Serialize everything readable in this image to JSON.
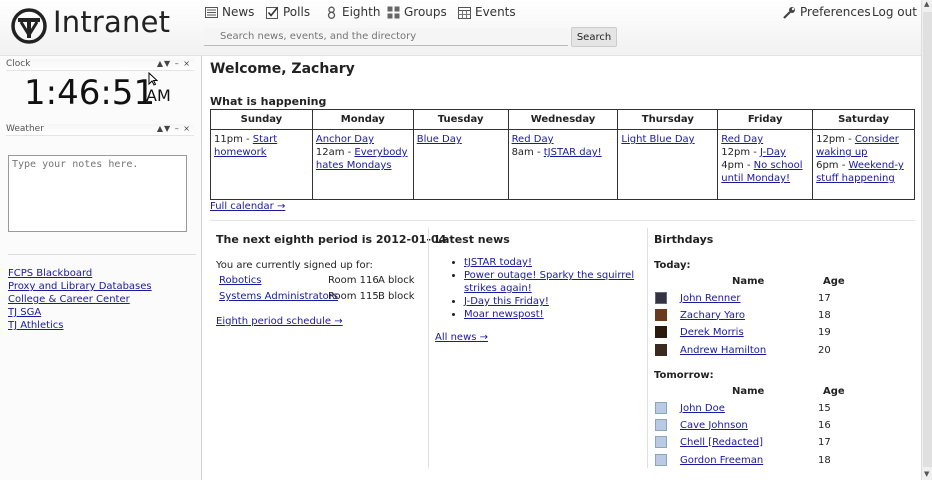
{
  "header": {
    "brand": "Intranet",
    "nav": [
      {
        "label": "News",
        "icon": "news-icon"
      },
      {
        "label": "Polls",
        "icon": "check-icon"
      },
      {
        "label": "Eighth",
        "icon": "eight-icon"
      },
      {
        "label": "Groups",
        "icon": "groups-icon"
      },
      {
        "label": "Events",
        "icon": "calendar-icon"
      }
    ],
    "preferences": "Preferences",
    "logout": "Log out",
    "search_placeholder": "Search news, events, and the directory",
    "search_button": "Search"
  },
  "sidebar": {
    "clock_title": "Clock",
    "time": "1:46:51",
    "ampm": "AM",
    "weather_title": "Weather",
    "widget_controls": "▲▼ – ×",
    "notes_placeholder": "Type your notes here.",
    "links": [
      "FCPS Blackboard",
      "Proxy and Library Databases",
      "College & Career Center",
      "TJ SGA",
      "TJ Athletics"
    ]
  },
  "main": {
    "welcome": "Welcome, Zachary",
    "happening_title": "What is happening",
    "days": [
      "Sunday",
      "Monday",
      "Tuesday",
      "Wednesday",
      "Thursday",
      "Friday",
      "Saturday"
    ],
    "calendar": [
      [
        {
          "t": "11pm - ",
          "l": "Start homework"
        }
      ],
      [
        {
          "t": "",
          "l": "Anchor Day"
        },
        {
          "t": "12am - ",
          "l": "Everybody hates Mondays"
        }
      ],
      [
        {
          "t": "",
          "l": "Blue Day"
        }
      ],
      [
        {
          "t": "",
          "l": "Red Day"
        },
        {
          "t": "8am - ",
          "l": "tJSTAR day!"
        }
      ],
      [
        {
          "t": "",
          "l": "Light Blue Day"
        }
      ],
      [
        {
          "t": "",
          "l": "Red Day"
        },
        {
          "t": "12pm - ",
          "l": "J-Day"
        },
        {
          "t": "4pm - ",
          "l": "No school until Monday!"
        }
      ],
      [
        {
          "t": "12pm - ",
          "l": "Consider waking up"
        },
        {
          "t": "6pm - ",
          "l": "Weekend-y stuff happening"
        }
      ]
    ],
    "full_calendar": "Full calendar →"
  },
  "eighth": {
    "title": "The next eighth period is 2012-01-04",
    "signed_up": "You are currently signed up for:",
    "rows": [
      {
        "name": "Robotics",
        "room": "Room 116",
        "block": "A block"
      },
      {
        "name": "Systems Administrators",
        "room": "Room 115",
        "block": "B block"
      }
    ],
    "schedule_link": "Eighth period schedule →"
  },
  "news": {
    "title": "Latest news",
    "items": [
      "tJSTAR today!",
      "Power outage! Sparky the squirrel strikes again!",
      "J-Day this Friday!",
      "Moar newspost!"
    ],
    "all_link": "All news →"
  },
  "birthdays": {
    "title": "Birthdays",
    "today_label": "Today:",
    "tomorrow_label": "Tomorrow:",
    "col_name": "Name",
    "col_age": "Age",
    "today": [
      {
        "name": "John Renner",
        "age": "17"
      },
      {
        "name": "Zachary Yaro",
        "age": "18"
      },
      {
        "name": "Derek Morris",
        "age": "19"
      },
      {
        "name": "Andrew Hamilton",
        "age": "20"
      }
    ],
    "tomorrow": [
      {
        "name": "John Doe",
        "age": "15"
      },
      {
        "name": "Cave Johnson",
        "age": "16"
      },
      {
        "name": "Chell [Redacted]",
        "age": "17"
      },
      {
        "name": "Gordon Freeman",
        "age": "18"
      }
    ]
  }
}
